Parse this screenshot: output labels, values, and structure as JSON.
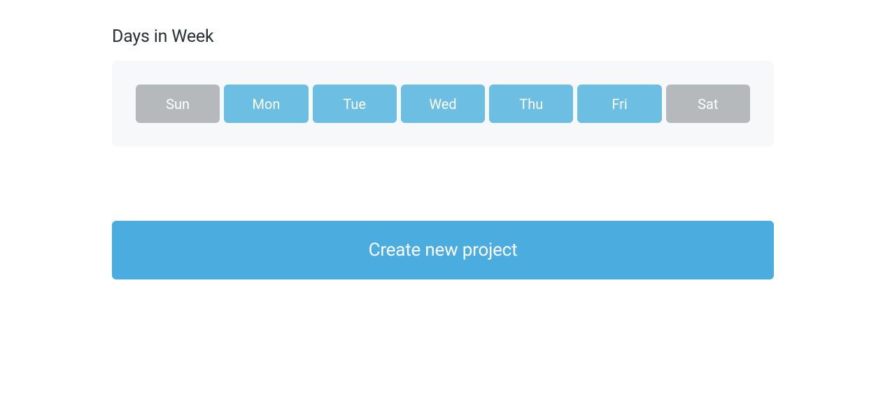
{
  "section": {
    "title": "Days in Week"
  },
  "days": [
    {
      "label": "Sun",
      "selected": false
    },
    {
      "label": "Mon",
      "selected": true
    },
    {
      "label": "Tue",
      "selected": true
    },
    {
      "label": "Wed",
      "selected": true
    },
    {
      "label": "Thu",
      "selected": true
    },
    {
      "label": "Fri",
      "selected": true
    },
    {
      "label": "Sat",
      "selected": false
    }
  ],
  "actions": {
    "create_project_label": "Create new project"
  }
}
